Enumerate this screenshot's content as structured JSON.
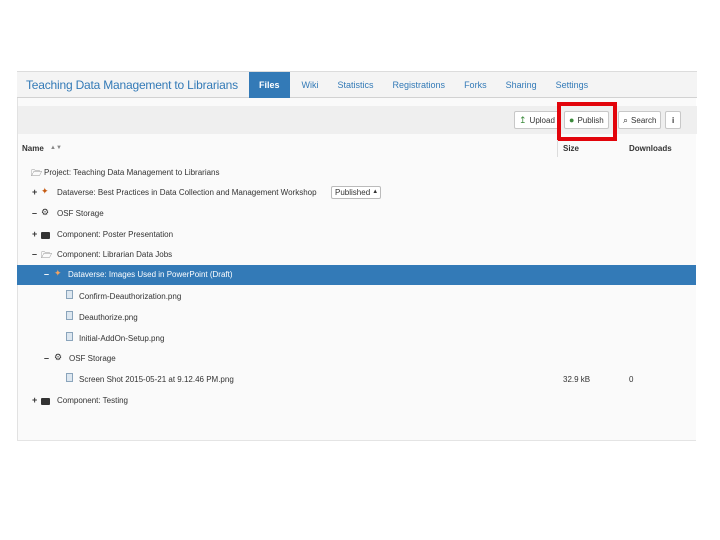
{
  "nav": {
    "project_title": "Teaching Data Management to Librarians",
    "tabs": [
      {
        "label": "Files",
        "active": true
      },
      {
        "label": "Wiki"
      },
      {
        "label": "Statistics"
      },
      {
        "label": "Registrations"
      },
      {
        "label": "Forks"
      },
      {
        "label": "Sharing"
      },
      {
        "label": "Settings"
      }
    ]
  },
  "toolbar": {
    "upload_label": "Upload",
    "publish_label": "Publish",
    "search_label": "Search",
    "info_label": "i"
  },
  "columns": {
    "name": "Name",
    "sort": "▲▼",
    "size": "Size",
    "downloads": "Downloads"
  },
  "rows": [
    {
      "toggle": "",
      "icon": "open-folder-icon",
      "label": "Project: Teaching Data Management to Librarians"
    },
    {
      "toggle": "+",
      "icon": "dataverse-icon",
      "label": "Dataverse: Best Practices in Data Collection and Management Workshop",
      "select": "Published"
    },
    {
      "toggle": "–",
      "icon": "storage-icon",
      "label": "OSF Storage"
    },
    {
      "toggle": "+",
      "icon": "folder-icon",
      "label": "Component: Poster Presentation"
    },
    {
      "toggle": "–",
      "icon": "open-folder-icon",
      "label": "Component: Librarian Data Jobs"
    },
    {
      "toggle": "–",
      "icon": "dataverse-icon",
      "label": "Dataverse: Images Used in PowerPoint (Draft)",
      "selected": true
    },
    {
      "toggle": "",
      "icon": "file-icon",
      "label": "Confirm-Deauthorization.png"
    },
    {
      "toggle": "",
      "icon": "file-icon",
      "label": "Deauthorize.png"
    },
    {
      "toggle": "",
      "icon": "file-icon",
      "label": "Initial-AddOn-Setup.png"
    },
    {
      "toggle": "–",
      "icon": "storage-icon",
      "label": "OSF Storage"
    },
    {
      "toggle": "",
      "icon": "file-icon",
      "label": "Screen Shot 2015-05-21 at 9.12.46 PM.png",
      "size": "32.9 kB",
      "downloads": "0"
    },
    {
      "toggle": "+",
      "icon": "folder-icon",
      "label": "Component: Testing"
    }
  ]
}
